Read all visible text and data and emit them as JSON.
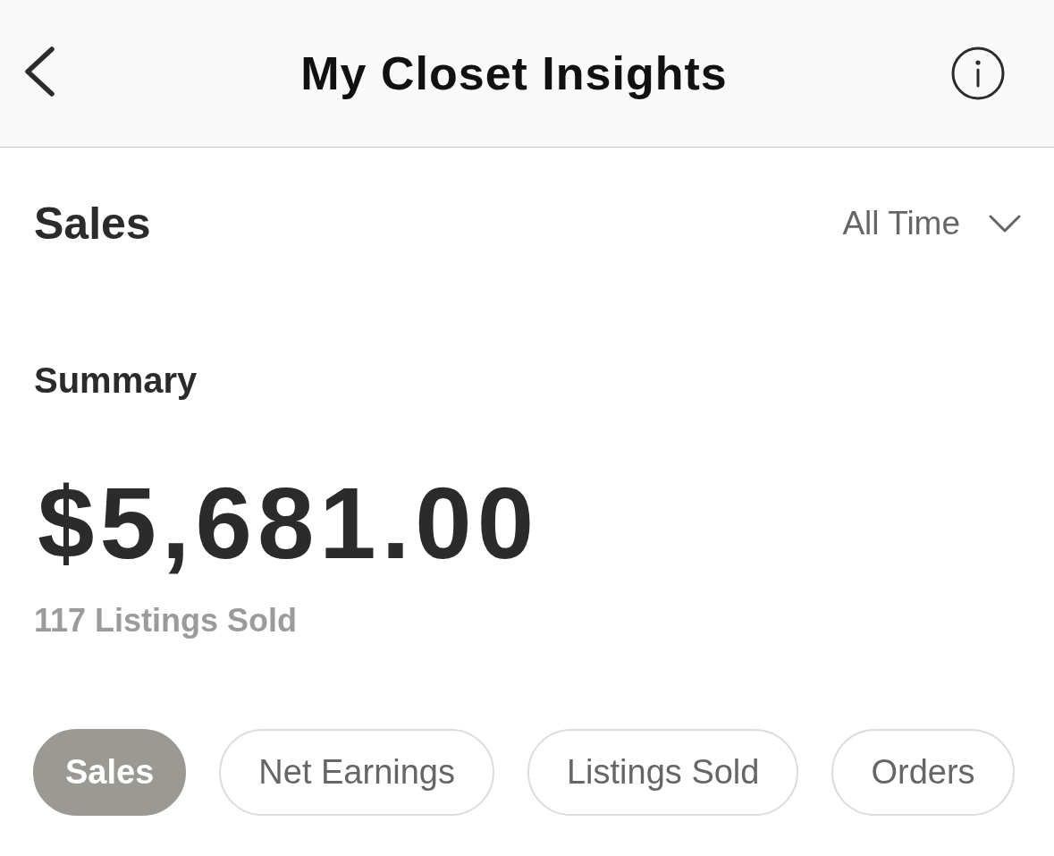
{
  "header": {
    "title": "My Closet Insights"
  },
  "section": {
    "title": "Sales",
    "period": "All Time"
  },
  "summary": {
    "heading": "Summary",
    "amount": "$5,681.00",
    "subtitle": "117 Listings Sold"
  },
  "metric_tabs": [
    {
      "label": "Sales",
      "selected": true
    },
    {
      "label": "Net Earnings",
      "selected": false
    },
    {
      "label": "Listings Sold",
      "selected": false
    },
    {
      "label": "Orders",
      "selected": false
    }
  ]
}
